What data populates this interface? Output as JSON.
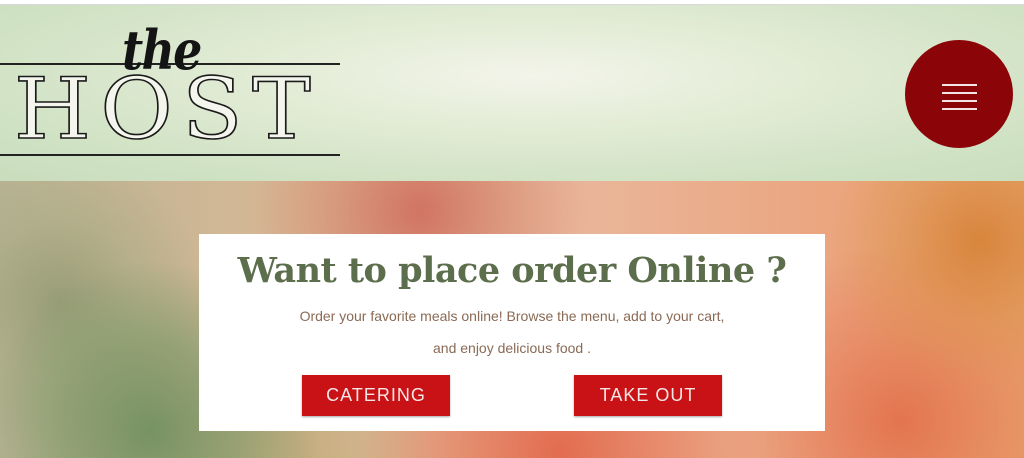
{
  "header": {
    "logo": {
      "the": "the",
      "host": "HOST"
    },
    "menu_icon": "hamburger-menu-icon"
  },
  "order_card": {
    "title": "Want to place order Online ?",
    "description": "Order your favorite meals online! Browse the menu, add to your cart, and enjoy delicious food .",
    "buttons": {
      "catering": "CATERING",
      "take_out": "TAKE OUT"
    }
  },
  "colors": {
    "header_bg": "#d2e3c6",
    "menu_button": "#8b0508",
    "cta_button": "#c81216",
    "title_text": "#5c6e4c",
    "body_text": "#8a6a55"
  }
}
